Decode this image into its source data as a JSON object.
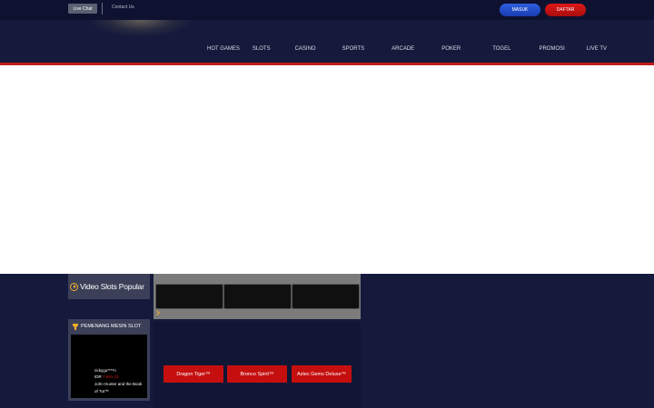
{
  "topbar": {
    "live_chat": "Live Chat",
    "contact": "Contact Us",
    "login": "MASUK",
    "register": "DAFTAR"
  },
  "nav": [
    "HOT GAMES",
    "SLOTS",
    "CASINO",
    "SPORTS",
    "ARCADE",
    "POKER",
    "TOGEL",
    "PROMOSI",
    "LIVE TV"
  ],
  "video_slots": {
    "title": "Video Slots Popular"
  },
  "winners": {
    "title": "PEMENANG MESIN SLOT",
    "name": "rickygu****n",
    "currency": "IDR",
    "amount": "7,691.23",
    "game": "John Hunter and the Book of Tut™"
  },
  "games": [
    "Dragon Tiger™",
    "Bronco Spirit™",
    "Aztec Gems Deluxe™"
  ],
  "colors": {
    "accent_red": "#c21818",
    "login_blue": "#2446c8",
    "bg": "#151a3c",
    "gold": "#f0b02a"
  }
}
